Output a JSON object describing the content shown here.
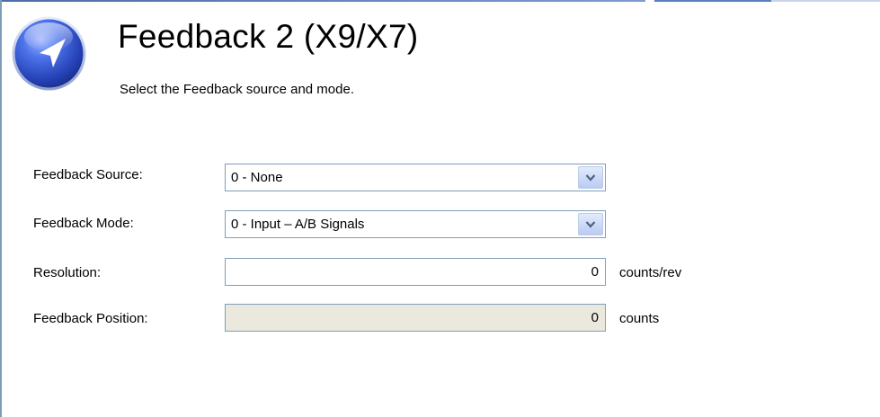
{
  "header": {
    "title": "Feedback 2 (X9/X7)",
    "subtitle": "Select the Feedback source and mode.",
    "icon": "feedback-arrow-icon"
  },
  "form": {
    "feedback_source": {
      "label": "Feedback Source:",
      "value": "0 - None"
    },
    "feedback_mode": {
      "label": "Feedback Mode:",
      "value": "0 - Input – A/B Signals"
    },
    "resolution": {
      "label": "Resolution:",
      "value": "0",
      "unit": "counts/rev"
    },
    "feedback_position": {
      "label": "Feedback Position:",
      "value": "0",
      "unit": "counts"
    }
  },
  "colors": {
    "accent": "#3a5fd6",
    "border": "#7f9db9",
    "readonly_bg": "#ebe9dd",
    "dropdown_btn": "#c6d5f7"
  }
}
